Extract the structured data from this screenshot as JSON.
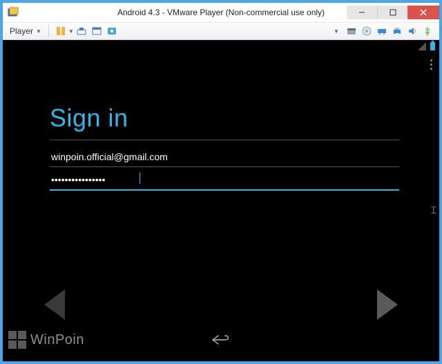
{
  "window": {
    "title": "Android 4.3 - VMware Player (Non-commercial use only)"
  },
  "toolbar": {
    "player_label": "Player"
  },
  "signin": {
    "heading": "Sign in",
    "email_value": "winpoin.official@gmail.com",
    "password_value": "••••••••••••••••"
  },
  "watermark": {
    "text": "WinPoin"
  },
  "icons": {
    "app": "vmware-icon",
    "signal": "signal-icon",
    "battery": "battery-icon",
    "overflow": "overflow-menu-icon",
    "back": "back-icon"
  }
}
